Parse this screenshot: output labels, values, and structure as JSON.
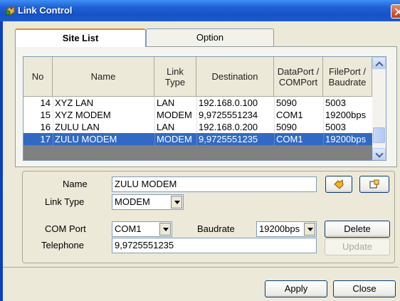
{
  "window": {
    "title": "Link Control"
  },
  "tabs": [
    {
      "label": "Site List",
      "active": true
    },
    {
      "label": "Option",
      "active": false
    }
  ],
  "table": {
    "headers": {
      "no": "No",
      "name": "Name",
      "link_type": [
        "Link",
        "Type"
      ],
      "destination": "Destination",
      "dataport": [
        "DataPort /",
        "COMPort"
      ],
      "fileport": [
        "FilePort /",
        "Baudrate"
      ]
    },
    "rows": [
      {
        "no": "14",
        "name": "XYZ LAN",
        "link_type": "LAN",
        "destination": "192.168.0.100",
        "dataport": "5090",
        "fileport": "5003",
        "selected": false
      },
      {
        "no": "15",
        "name": "XYZ MODEM",
        "link_type": "MODEM",
        "destination": "9,9725551234",
        "dataport": "COM1",
        "fileport": "19200bps",
        "selected": false
      },
      {
        "no": "16",
        "name": "ZULU LAN",
        "link_type": "LAN",
        "destination": "192.168.0.200",
        "dataport": "5090",
        "fileport": "5003",
        "selected": false
      },
      {
        "no": "17",
        "name": "ZULU MODEM",
        "link_type": "MODEM",
        "destination": "9,9725551235",
        "dataport": "COM1",
        "fileport": "19200bps",
        "selected": true
      }
    ]
  },
  "form": {
    "name_label": "Name",
    "name_value": "ZULU MODEM",
    "link_type_label": "Link Type",
    "link_type_value": "MODEM",
    "com_port_label": "COM Port",
    "com_port_value": "COM1",
    "baudrate_label": "Baudrate",
    "baudrate_value": "19200bps",
    "telephone_label": "Telephone",
    "telephone_value": "9,9725551235"
  },
  "buttons": {
    "delete": "Delete",
    "update": "Update",
    "apply": "Apply",
    "close": "Close"
  },
  "icons": {
    "title": "link-control-app-icon",
    "connect": "connect-icon",
    "disconnect": "disconnect-icon"
  },
  "colors": {
    "titlebar": "#1652c8",
    "selection": "#316ac5",
    "tab_accent": "#e68b2c"
  }
}
